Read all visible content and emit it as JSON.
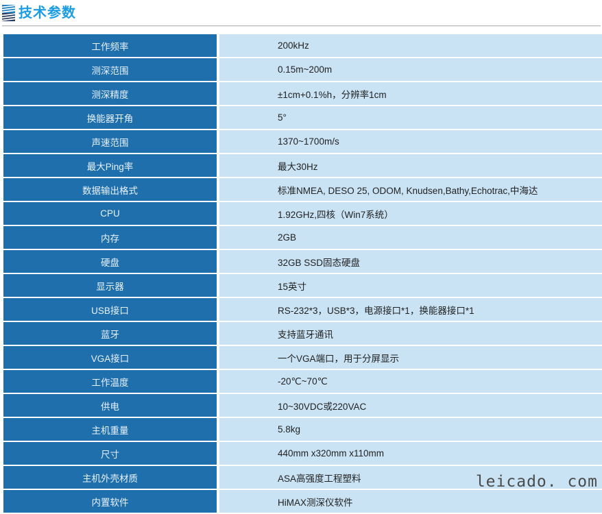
{
  "header": {
    "title": "技术参数",
    "logo_icon": "striped-square-logo-icon"
  },
  "table": {
    "rows": [
      {
        "label": "工作频率",
        "value": "200kHz"
      },
      {
        "label": "测深范围",
        "value": "0.15m~200m"
      },
      {
        "label": "测深精度",
        "value": "±1cm+0.1%h，分辨率1cm"
      },
      {
        "label": "换能器开角",
        "value": "5°"
      },
      {
        "label": "声速范围",
        "value": "1370~1700m/s"
      },
      {
        "label": "最大Ping率",
        "value": "最大30Hz"
      },
      {
        "label": "数据输出格式",
        "value": "标准NMEA, DESO 25, ODOM, Knudsen,Bathy,Echotrac,中海达"
      },
      {
        "label": "CPU",
        "value": "1.92GHz,四核（Win7系统）"
      },
      {
        "label": "内存",
        "value": "2GB"
      },
      {
        "label": "硬盘",
        "value": "32GB SSD固态硬盘"
      },
      {
        "label": "显示器",
        "value": "15英寸"
      },
      {
        "label": "USB接口",
        "value": "RS-232*3，USB*3，电源接口*1，换能器接口*1"
      },
      {
        "label": "蓝牙",
        "value": "支持蓝牙通讯"
      },
      {
        "label": "VGA接口",
        "value": "一个VGA端口，用于分屏显示"
      },
      {
        "label": "工作温度",
        "value": "-20℃~70℃"
      },
      {
        "label": "供电",
        "value": "10~30VDC或220VAC"
      },
      {
        "label": "主机重量",
        "value": "5.8kg"
      },
      {
        "label": "尺寸",
        "value": "440mm x320mm x110mm"
      },
      {
        "label": "主机外壳材质",
        "value": "ASA高强度工程塑料"
      },
      {
        "label": "内置软件",
        "value": "HiMAX测深仪软件"
      }
    ]
  },
  "watermark": {
    "text": "leicado. com"
  },
  "colors": {
    "title_blue": "#1c9ce2",
    "label_cell_blue": "#1e6fac",
    "value_cell_blue": "#c9e3f4",
    "rule_gray": "#b9b9b9",
    "watermark_gray": "#4b4b4b"
  }
}
